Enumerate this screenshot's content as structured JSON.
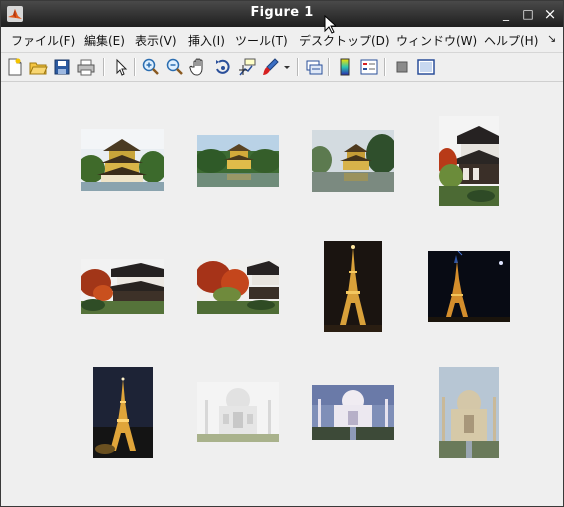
{
  "window": {
    "title": "Figure 1",
    "controls": {
      "minimize": "_",
      "maximize": "□",
      "close": "×"
    }
  },
  "menubar": {
    "items": [
      "ファイル(F)",
      "編集(E)",
      "表示(V)",
      "挿入(I)",
      "ツール(T)",
      "デスクトップ(D)",
      "ウィンドウ(W)",
      "ヘルプ(H)"
    ],
    "overflow": "↘"
  },
  "toolbar": {
    "icons": [
      "new-figure-icon",
      "open-file-icon",
      "save-icon",
      "print-icon",
      "edit-plot-arrow-icon",
      "zoom-in-icon",
      "zoom-out-icon",
      "pan-hand-icon",
      "rotate-3d-icon",
      "data-cursor-icon",
      "brush-icon",
      "brush-dropdown-icon",
      "link-plot-icon",
      "colorbar-icon",
      "legend-icon",
      "hide-plot-tools-icon",
      "show-plot-tools-icon"
    ]
  },
  "figure": {
    "images": [
      {
        "subject": "kinkakuji-golden-pavilion"
      },
      {
        "subject": "kinkakuji-golden-pavilion"
      },
      {
        "subject": "kinkakuji-golden-pavilion"
      },
      {
        "subject": "kyoto-temple-autumn"
      },
      {
        "subject": "kyoto-temple-autumn"
      },
      {
        "subject": "kyoto-temple-autumn"
      },
      {
        "subject": "eiffel-tower-night"
      },
      {
        "subject": "eiffel-tower-night"
      },
      {
        "subject": "eiffel-tower-night"
      },
      {
        "subject": "taj-mahal"
      },
      {
        "subject": "taj-mahal"
      },
      {
        "subject": "taj-mahal"
      }
    ]
  },
  "colors": {
    "titlebar": "#2b2b2b",
    "menubar_bg": "#efefef",
    "canvas_bg": "#efefef"
  }
}
